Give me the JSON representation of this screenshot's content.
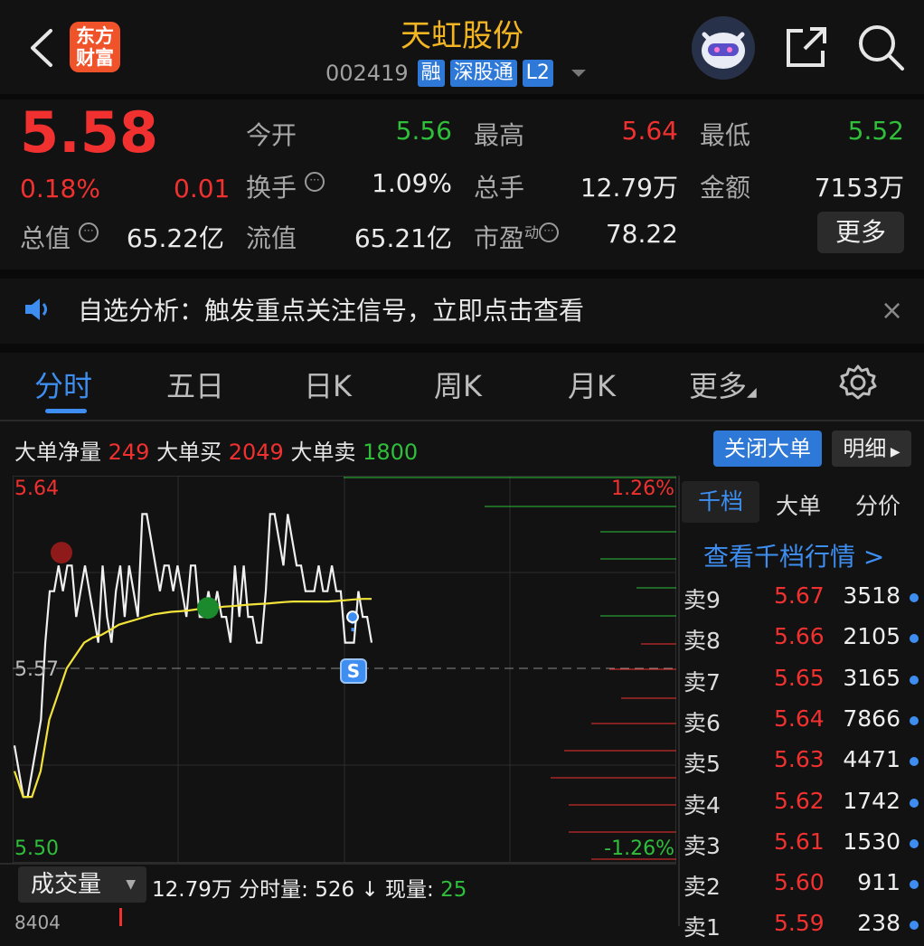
{
  "header": {
    "logo_text_line1": "东方",
    "logo_text_line2": "财富",
    "title": "天虹股份",
    "code": "002419",
    "tags": [
      "融",
      "深股通",
      "L2"
    ]
  },
  "quote": {
    "price": "5.58",
    "change_pct": "0.18%",
    "change": "0.01",
    "fields": [
      {
        "label": "今开",
        "value": "5.56",
        "color": "green"
      },
      {
        "label": "最高",
        "value": "5.64",
        "color": "red"
      },
      {
        "label": "最低",
        "value": "5.52",
        "color": "green"
      },
      {
        "label": "换手",
        "value": "1.09%",
        "color": "white"
      },
      {
        "label": "总手",
        "value": "12.79万",
        "color": "white"
      },
      {
        "label": "金额",
        "value": "7153万",
        "color": "white"
      },
      {
        "label": "总值",
        "value": "65.22亿",
        "color": "white"
      },
      {
        "label": "流值",
        "value": "65.21亿",
        "color": "white"
      },
      {
        "label": "市盈",
        "value": "78.22",
        "color": "white",
        "superscript": "动"
      }
    ],
    "more_label": "更多"
  },
  "notice": {
    "text": "自选分析：触发重点关注信号，立即点击查看",
    "close": "×"
  },
  "tabs": [
    "分时",
    "五日",
    "日K",
    "周K",
    "月K",
    "更多"
  ],
  "big_orders": {
    "net_label": "大单净量",
    "net_value": "249",
    "buy_label": "大单买",
    "buy_value": "2049",
    "sell_label": "大单卖",
    "sell_value": "1800",
    "close_button": "关闭大单",
    "detail_button": "明细"
  },
  "chart_data": {
    "type": "line",
    "y_max_label": "5.64",
    "y_mid_label": "5.57",
    "y_min_label": "5.50",
    "pct_max_label": "1.26%",
    "pct_min_label": "-1.26%",
    "ylim": [
      5.5,
      5.64
    ],
    "base": 5.57,
    "series": [
      {
        "values": [
          5.54,
          5.53,
          5.52,
          5.52,
          5.53,
          5.54,
          5.55,
          5.58,
          5.6,
          5.6,
          5.61,
          5.6,
          5.61,
          5.61,
          5.59,
          5.6,
          5.61,
          5.6,
          5.59,
          5.58,
          5.61,
          5.59,
          5.58,
          5.6,
          5.61,
          5.59,
          5.61,
          5.6,
          5.59,
          5.63,
          5.63,
          5.62,
          5.61,
          5.6,
          5.61,
          5.61,
          5.6,
          5.61,
          5.6,
          5.59,
          5.61,
          5.61,
          5.59,
          5.59,
          5.6,
          5.59,
          5.6,
          5.59,
          5.59,
          5.58,
          5.61,
          5.59,
          5.61,
          5.59,
          5.59,
          5.58,
          5.58,
          5.6,
          5.63,
          5.63,
          5.62,
          5.61,
          5.63,
          5.62,
          5.61,
          5.61,
          5.6,
          5.6,
          5.6,
          5.61,
          5.6,
          5.6,
          5.61,
          5.6,
          5.6,
          5.58,
          5.58,
          5.58,
          5.6,
          5.59,
          5.59,
          5.58
        ]
      },
      {
        "values": [
          5.53,
          5.52,
          5.52,
          5.53,
          5.55,
          5.56,
          5.57,
          5.575,
          5.58,
          5.582,
          5.583,
          5.585,
          5.587,
          5.588,
          5.589,
          5.59,
          5.591,
          5.5915,
          5.592,
          5.5922,
          5.5925,
          5.593,
          5.5932,
          5.5935,
          5.594,
          5.5942,
          5.5945,
          5.5948,
          5.595,
          5.5952,
          5.5955,
          5.5958,
          5.596,
          5.596,
          5.596,
          5.596,
          5.596,
          5.5962,
          5.5965,
          5.5968,
          5.597,
          5.597
        ]
      }
    ],
    "buy_signal_price": 5.61,
    "sell_signal_price": 5.58,
    "signal_label": "S"
  },
  "orderbook": {
    "tabs": [
      "千档",
      "大单",
      "分价"
    ],
    "link": "查看千档行情 >",
    "rows": [
      {
        "side": "卖9",
        "price": "5.67",
        "vol": "3518"
      },
      {
        "side": "卖8",
        "price": "5.66",
        "vol": "2105"
      },
      {
        "side": "卖7",
        "price": "5.65",
        "vol": "3165"
      },
      {
        "side": "卖6",
        "price": "5.64",
        "vol": "7866"
      },
      {
        "side": "卖5",
        "price": "5.63",
        "vol": "4471"
      },
      {
        "side": "卖4",
        "price": "5.62",
        "vol": "1742"
      },
      {
        "side": "卖3",
        "price": "5.61",
        "vol": "1530"
      },
      {
        "side": "卖2",
        "price": "5.60",
        "vol": "911"
      },
      {
        "side": "卖1",
        "price": "5.59",
        "vol": "238"
      }
    ]
  },
  "volume": {
    "select": "成交量",
    "total": "12.79万",
    "minute_label": "分时量:",
    "minute_value": "526",
    "arrow": "↓",
    "current_label": "现量:",
    "current_value": "25",
    "max_label": "8404"
  }
}
